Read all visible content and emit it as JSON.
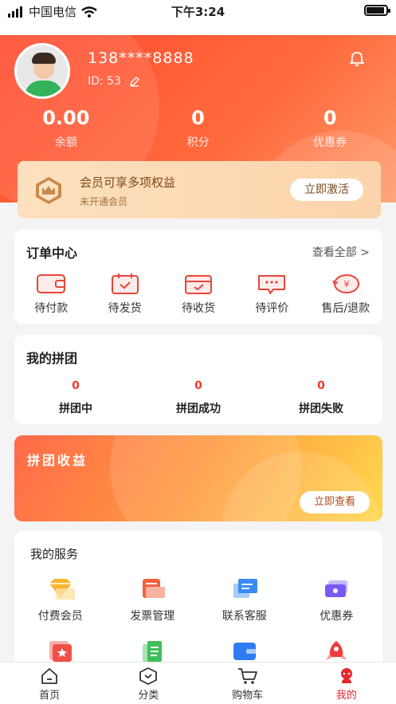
{
  "status_bar": {
    "carrier": "中国电信",
    "time": "下午3:24"
  },
  "profile": {
    "phone": "138****8888",
    "id": "ID: 53",
    "stats": [
      {
        "value": "0.00",
        "label": "余额"
      },
      {
        "value": "0",
        "label": "积分"
      },
      {
        "value": "0",
        "label": "优惠券"
      }
    ]
  },
  "vip": {
    "title": "会员可享多项权益",
    "subtitle": "未开通会员",
    "button": "立即激活"
  },
  "orders": {
    "title": "订单中心",
    "more": "查看全部 >",
    "items": [
      {
        "label": "待付款",
        "icon": "wallet-icon"
      },
      {
        "label": "待发货",
        "icon": "calendar-check-icon"
      },
      {
        "label": "待收货",
        "icon": "package-icon"
      },
      {
        "label": "待评价",
        "icon": "comment-icon"
      },
      {
        "label": "售后/退款",
        "icon": "refund-icon"
      }
    ]
  },
  "group": {
    "title": "我的拼团",
    "items": [
      {
        "value": "0",
        "label": "拼团中"
      },
      {
        "value": "0",
        "label": "拼团成功"
      },
      {
        "value": "0",
        "label": "拼团失败"
      }
    ]
  },
  "earnings": {
    "title": "拼团收益",
    "button": "立即查看"
  },
  "services": {
    "title": "我的服务",
    "row1": [
      {
        "label": "付费会员",
        "icon": "diamond-icon",
        "color": "#f8b62d"
      },
      {
        "label": "发票管理",
        "icon": "invoice-icon",
        "color": "#f4603e"
      },
      {
        "label": "联系客服",
        "icon": "chat-icon",
        "color": "#3a8bf2"
      },
      {
        "label": "优惠券",
        "icon": "ticket-icon",
        "color": "#7a5af5"
      }
    ],
    "row2_icons": [
      {
        "icon": "star-card-icon",
        "color": "#f0504a"
      },
      {
        "icon": "document-icon",
        "color": "#3fbf5b"
      },
      {
        "icon": "card-icon",
        "color": "#2f7bf2"
      },
      {
        "icon": "rocket-icon",
        "color": "#ef3b3b"
      }
    ]
  },
  "tabbar": [
    {
      "label": "首页",
      "icon": "home-icon"
    },
    {
      "label": "分类",
      "icon": "category-icon"
    },
    {
      "label": "购物车",
      "icon": "cart-icon"
    },
    {
      "label": "我的",
      "icon": "profile-icon",
      "active": true
    }
  ]
}
